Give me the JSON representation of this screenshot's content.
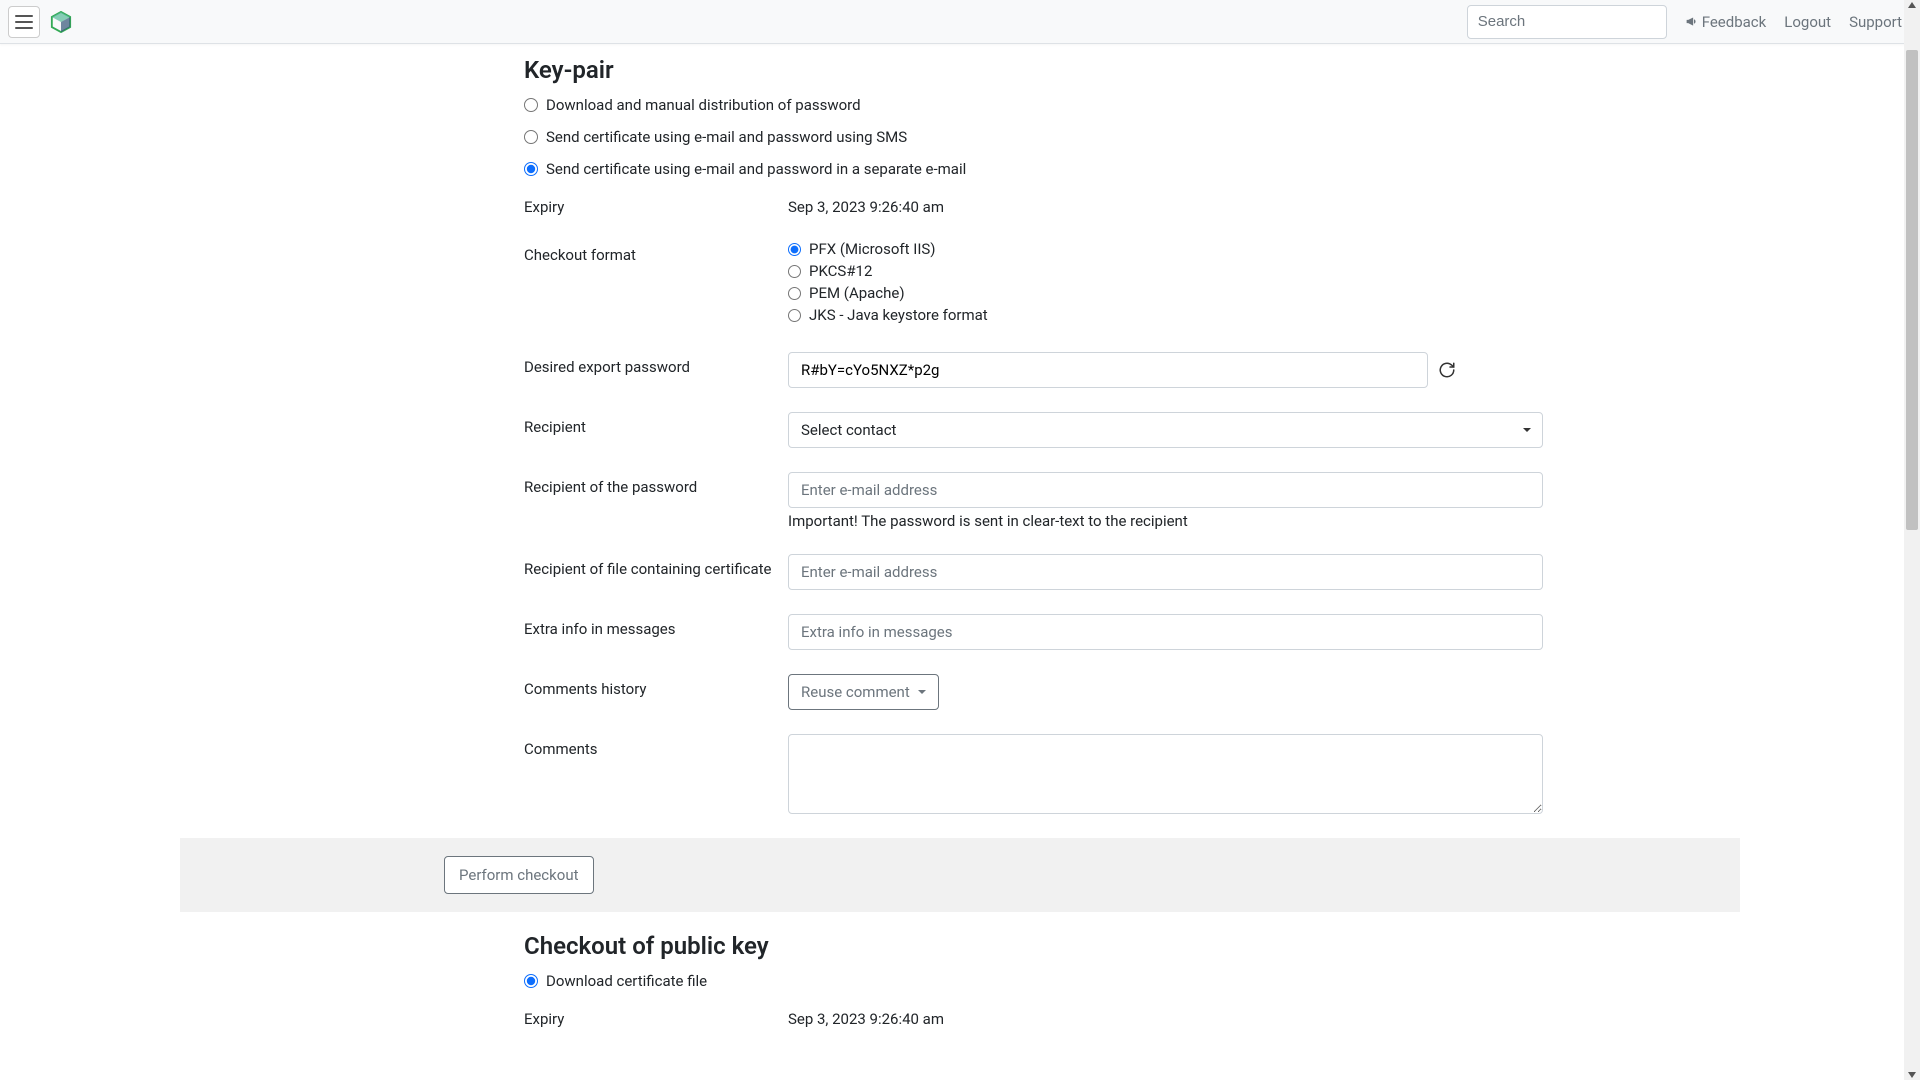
{
  "navbar": {
    "search_placeholder": "Search",
    "feedback_label": "Feedback",
    "logout_label": "Logout",
    "support_label": "Support"
  },
  "keypair": {
    "title": "Key-pair",
    "distribution_options": [
      {
        "label": "Download and manual distribution of password"
      },
      {
        "label": "Send certificate using e-mail and password using SMS"
      },
      {
        "label": "Send certificate using e-mail and password in a separate e-mail"
      }
    ],
    "expiry_label": "Expiry",
    "expiry_value": "Sep 3, 2023 9:26:40 am",
    "checkout_format_label": "Checkout format",
    "format_options": [
      {
        "label": "PFX (Microsoft IIS)"
      },
      {
        "label": "PKCS#12"
      },
      {
        "label": "PEM (Apache)"
      },
      {
        "label": "JKS - Java keystore format"
      }
    ],
    "password_label": "Desired export password",
    "password_value": "R#bY=cYo5NXZ*p2g",
    "recipient_label": "Recipient",
    "recipient_placeholder": "Select contact",
    "password_recipient_label": "Recipient of the password",
    "email_placeholder": "Enter e-mail address",
    "important_note": "Important! The password is sent in clear-text to the recipient",
    "cert_recipient_label": "Recipient of file containing certificate",
    "extra_info_label": "Extra info in messages",
    "extra_info_placeholder": "Extra info in messages",
    "comments_history_label": "Comments history",
    "reuse_comment_label": "Reuse comment",
    "comments_label": "Comments",
    "perform_checkout_label": "Perform checkout"
  },
  "publickey": {
    "title": "Checkout of public key",
    "download_label": "Download certificate file",
    "expiry_label": "Expiry",
    "expiry_value": "Sep 3, 2023 9:26:40 am"
  }
}
